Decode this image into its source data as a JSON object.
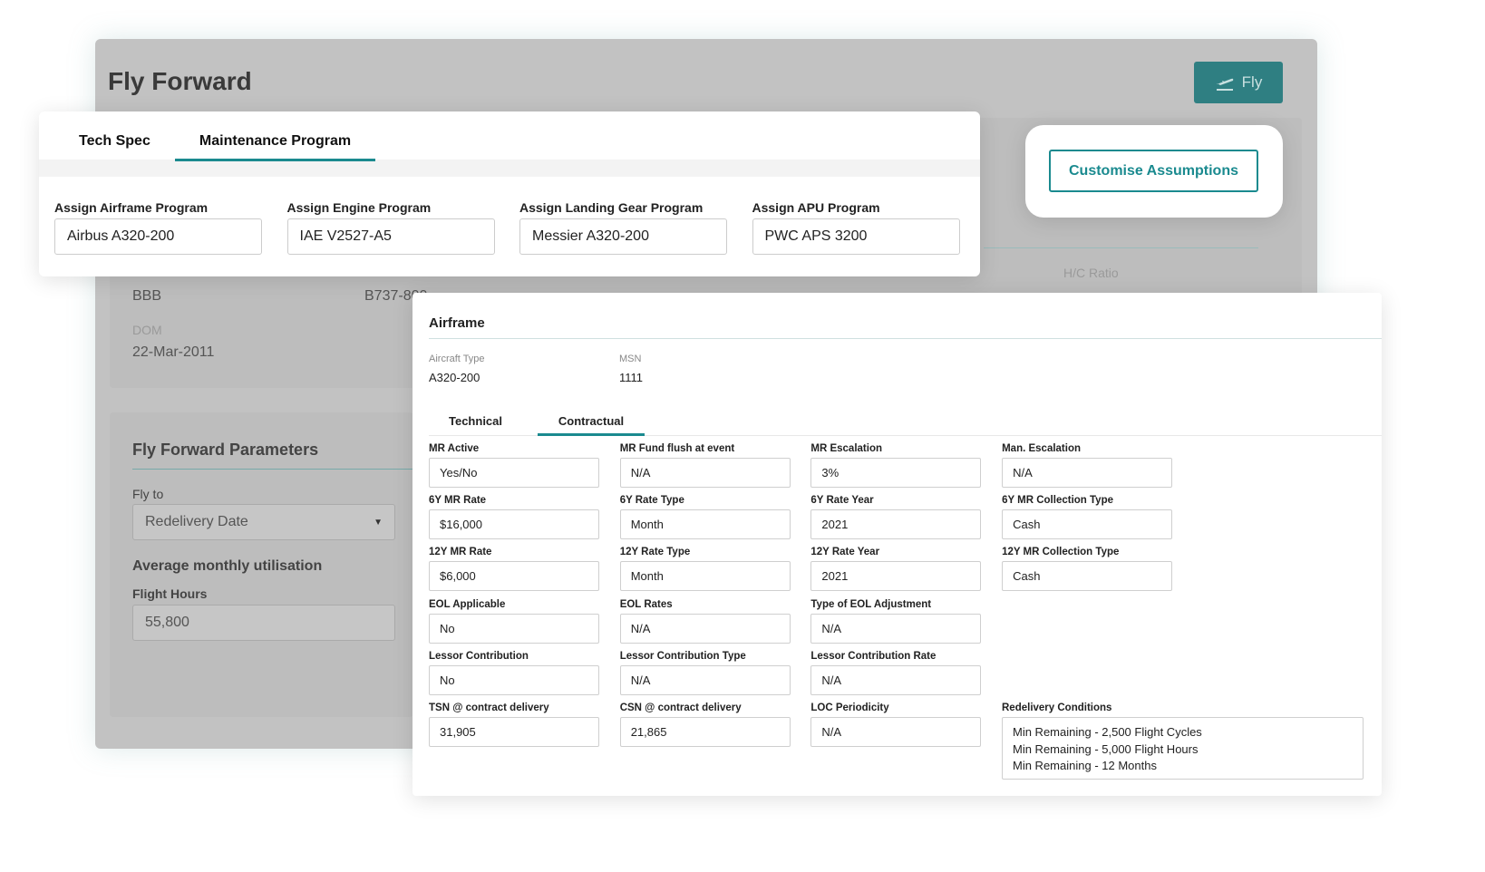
{
  "app": {
    "title": "Fly Forward",
    "fly_button": "Fly",
    "fly_icon": "airplane-takeoff-icon",
    "accent": "#1a8a8f"
  },
  "background": {
    "header_row": {
      "hc_label": "H/C Ratio"
    },
    "values": [
      "BBB",
      "B737-800"
    ],
    "dom_label": "DOM",
    "dom_value": "22-Mar-2011",
    "params_title": "Fly Forward Parameters",
    "fly_to_label": "Fly to",
    "fly_to_value": "Redelivery Date",
    "util_title": "Average monthly utilisation",
    "flight_hours_label": "Flight Hours",
    "flight_hours_value": "55,800"
  },
  "customise_button": "Customise Assumptions",
  "program_card": {
    "tabs": [
      "Tech Spec",
      "Maintenance Program"
    ],
    "active_tab": 1,
    "fields": [
      {
        "label": "Assign Airframe Program",
        "value": "Airbus A320-200"
      },
      {
        "label": "Assign Engine Program",
        "value": "IAE V2527-A5"
      },
      {
        "label": "Assign Landing Gear Program",
        "value": "Messier A320-200"
      },
      {
        "label": "Assign APU Program",
        "value": "PWC APS 3200"
      }
    ]
  },
  "airframe": {
    "title": "Airframe",
    "aircraft_type_label": "Aircraft Type",
    "aircraft_type": "A320-200",
    "msn_label": "MSN",
    "msn": "1111",
    "tabs": [
      "Technical",
      "Contractual"
    ],
    "active_tab": 1,
    "rows": [
      [
        {
          "label": "MR Active",
          "value": "Yes/No"
        },
        {
          "label": "MR Fund flush at event",
          "value": "N/A"
        },
        {
          "label": "MR Escalation",
          "value": "3%"
        },
        {
          "label": "Man. Escalation",
          "value": "N/A"
        }
      ],
      [
        {
          "label": "6Y MR Rate",
          "value": "$16,000"
        },
        {
          "label": "6Y Rate Type",
          "value": "Month"
        },
        {
          "label": "6Y Rate Year",
          "value": "2021"
        },
        {
          "label": "6Y MR Collection Type",
          "value": "Cash"
        }
      ],
      [
        {
          "label": "12Y MR Rate",
          "value": "$6,000"
        },
        {
          "label": "12Y Rate Type",
          "value": "Month"
        },
        {
          "label": "12Y Rate Year",
          "value": "2021"
        },
        {
          "label": "12Y MR Collection Type",
          "value": "Cash"
        }
      ],
      [
        {
          "label": "EOL Applicable",
          "value": "No"
        },
        {
          "label": "EOL Rates",
          "value": "N/A"
        },
        {
          "label": "Type of EOL Adjustment",
          "value": "N/A"
        }
      ],
      [
        {
          "label": "Lessor Contribution",
          "value": "No"
        },
        {
          "label": "Lessor Contribution Type",
          "value": "N/A"
        },
        {
          "label": "Lessor Contribution Rate",
          "value": "N/A"
        }
      ],
      [
        {
          "label": "TSN @ contract delivery",
          "value": "31,905"
        },
        {
          "label": "CSN @ contract delivery",
          "value": "21,865"
        },
        {
          "label": "LOC Periodicity",
          "value": "N/A"
        }
      ]
    ],
    "redelivery_label": "Redelivery Conditions",
    "redelivery_lines": [
      "Min Remaining - 2,500 Flight Cycles",
      "Min Remaining - 5,000 Flight Hours",
      "Min Remaining - 12 Months"
    ]
  }
}
